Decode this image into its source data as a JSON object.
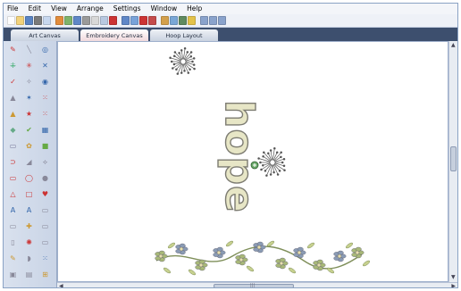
{
  "menu": {
    "items": [
      "File",
      "Edit",
      "View",
      "Arrange",
      "Settings",
      "Window",
      "Help"
    ]
  },
  "tabs": [
    {
      "label": "Art Canvas",
      "active": false
    },
    {
      "label": "Embroidery Canvas",
      "active": true
    },
    {
      "label": "Hoop Layout",
      "active": false
    }
  ],
  "canvas": {
    "design_text": "hope"
  },
  "colors": {
    "tab_bar": "#3d4f6e",
    "active_tab": "#f1d9dc",
    "thread_light": "#e7e6c6",
    "thread_outline": "#7d7c72",
    "flower_blue": "#8a9bb4",
    "flower_green": "#a8b878"
  },
  "toolbar_icons": [
    "new-icon",
    "open-icon",
    "save-icon",
    "print-icon",
    "preview-icon",
    "import-icon",
    "export-icon",
    "undo-icon",
    "cut-icon",
    "copy-icon",
    "paste-icon",
    "delete-icon",
    "redo-icon",
    "refresh-icon",
    "stop-icon",
    "color-icon",
    "hoop-icon",
    "thread-icon",
    "stitch-icon",
    "grid-icon",
    "zoom-in-icon",
    "zoom-out-icon",
    "zoom-fit-icon"
  ],
  "scrollbar": {
    "hscroll_mid": "|||"
  }
}
